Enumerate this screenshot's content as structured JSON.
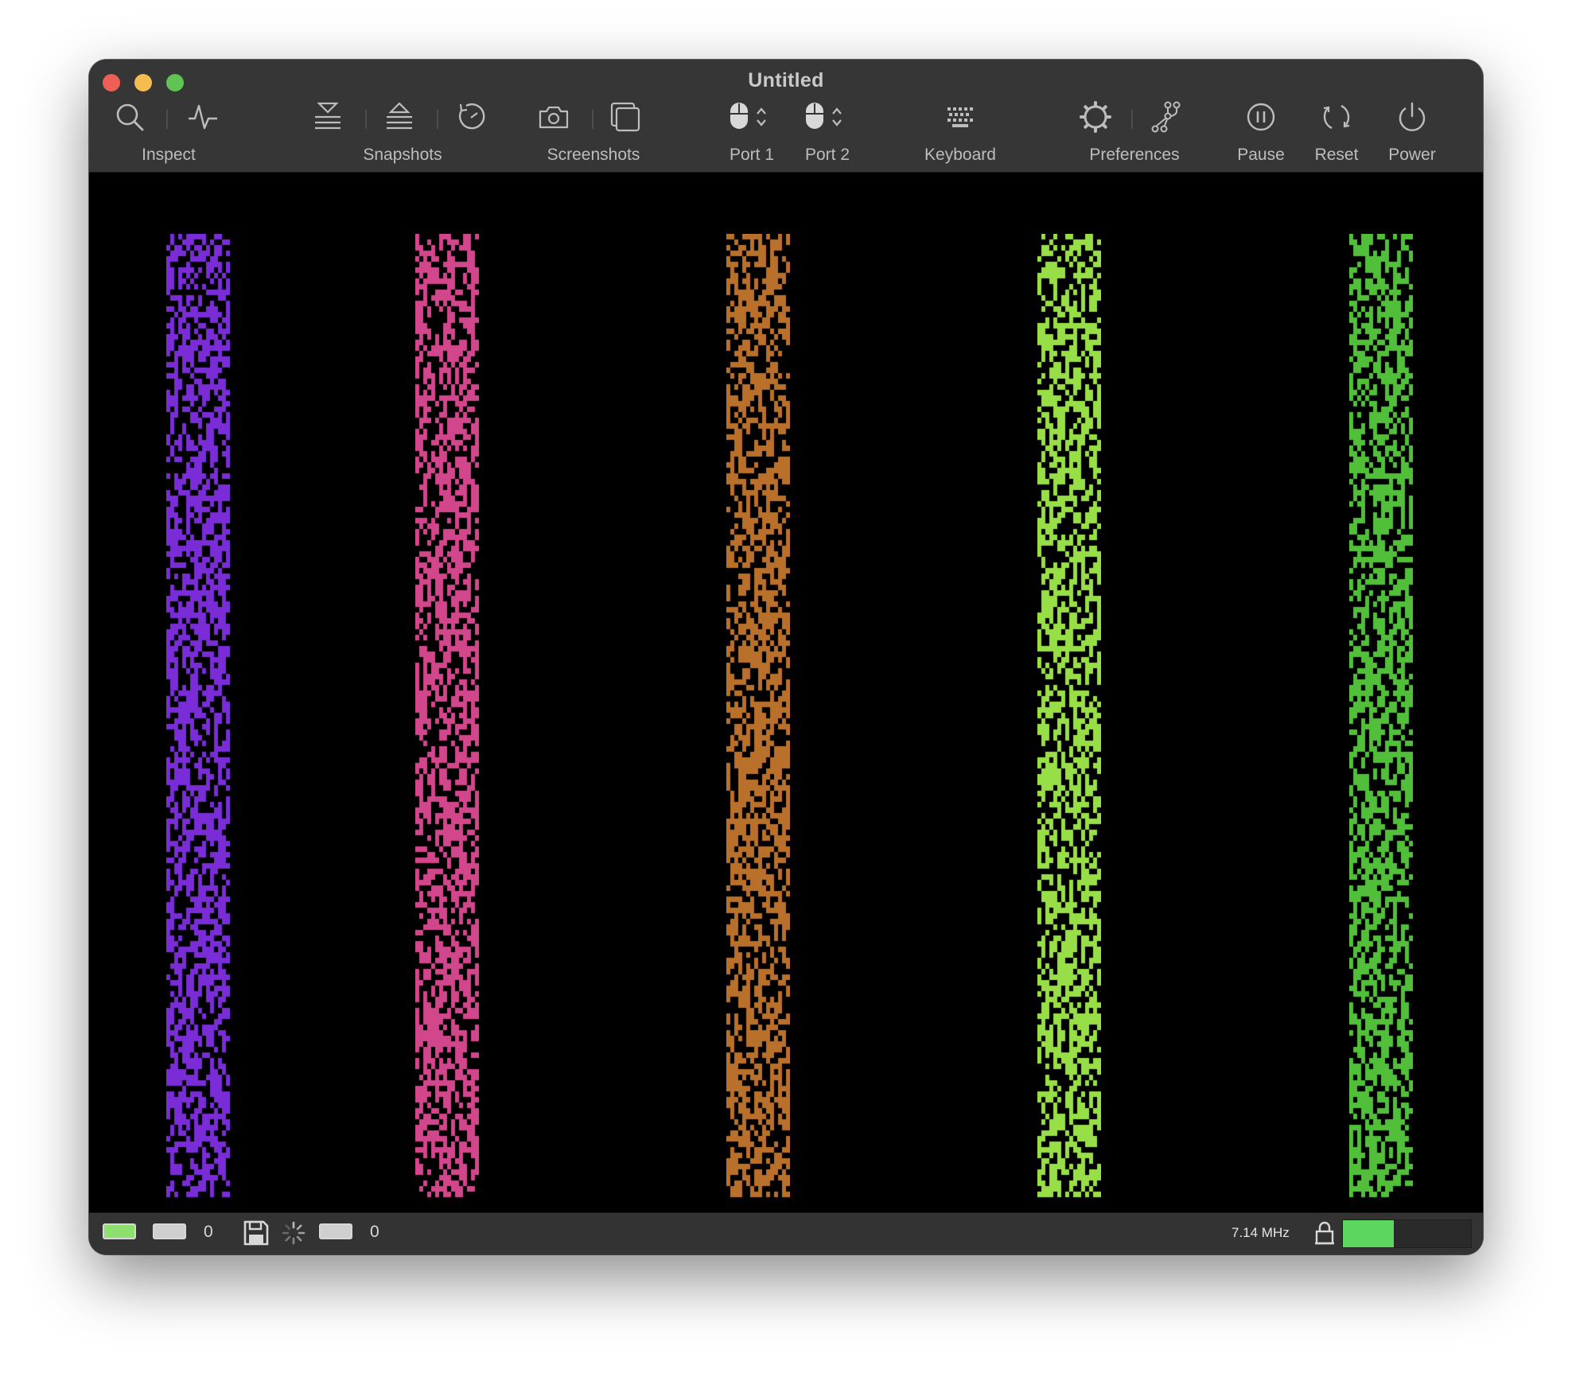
{
  "window": {
    "title": "Untitled"
  },
  "toolbar": {
    "inspect": {
      "label": "Inspect",
      "icons": [
        "search-icon",
        "activity-icon"
      ]
    },
    "snapshots": {
      "label": "Snapshots",
      "icons": [
        "snapshot-save-icon",
        "snapshot-restore-icon",
        "history-clock-icon"
      ]
    },
    "screenshots": {
      "label": "Screenshots",
      "icons": [
        "camera-icon",
        "gallery-icon"
      ]
    },
    "port1": {
      "label": "Port 1",
      "icons": [
        "mouse-icon",
        "chevron-updown-icon"
      ]
    },
    "port2": {
      "label": "Port 2",
      "icons": [
        "mouse-icon",
        "chevron-updown-icon"
      ]
    },
    "keyboard": {
      "label": "Keyboard",
      "icons": [
        "keyboard-icon"
      ]
    },
    "preferences": {
      "label": "Preferences",
      "icons": [
        "gear-icon",
        "branch-icon"
      ]
    },
    "pause": {
      "label": "Pause",
      "icons": [
        "pause-circle-icon"
      ]
    },
    "reset": {
      "label": "Reset",
      "icons": [
        "reset-icon"
      ]
    },
    "power": {
      "label": "Power",
      "icons": [
        "power-icon"
      ]
    }
  },
  "screen": {
    "background": "#000000",
    "stripe_colors": [
      "#7a2dd6",
      "#d2468c",
      "#b8702a",
      "#98de46",
      "#52bf3b"
    ]
  },
  "statusbar": {
    "drive1_led_color": "#8ee06e",
    "drive1_count": "0",
    "drive2_count": "0",
    "speed": "7.14 MHz",
    "meter_level_percent": 40,
    "meter_color": "#5dd65f"
  }
}
